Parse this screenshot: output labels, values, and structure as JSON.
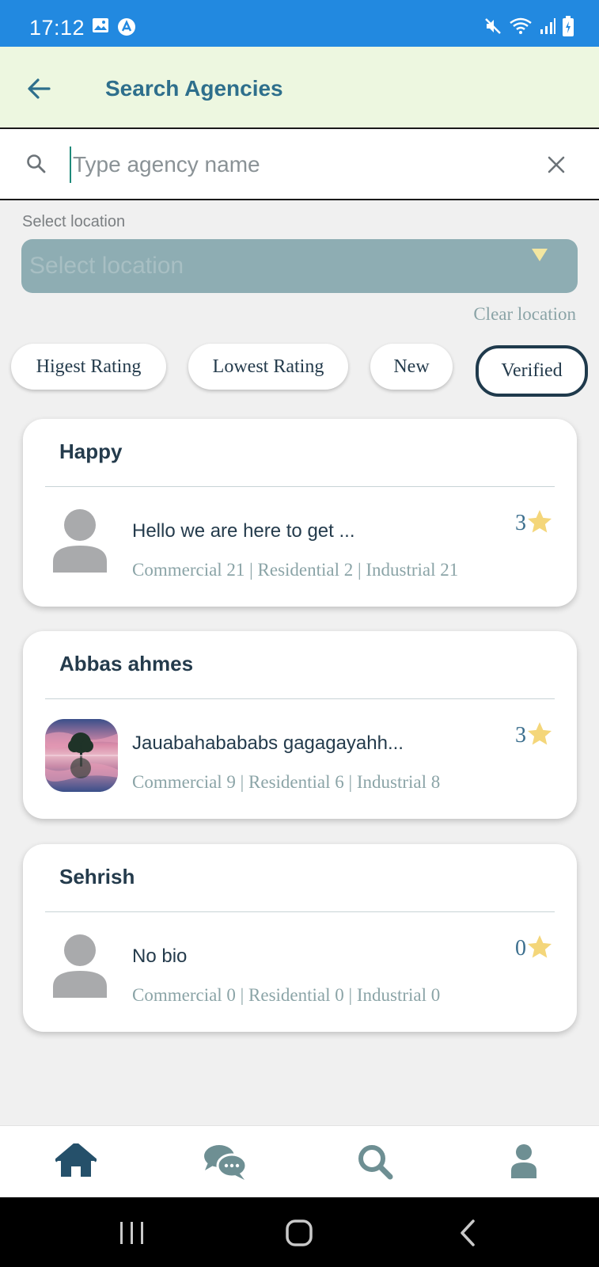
{
  "status_bar": {
    "time": "17:12",
    "left_icons": [
      "image-icon",
      "app-logo-icon"
    ],
    "right_icons": [
      "mute-icon",
      "wifi-icon",
      "signal-icon",
      "battery-icon"
    ],
    "background": "#2289e0"
  },
  "app_bar": {
    "title": "Search Agencies",
    "back_icon": "arrow-left-icon",
    "background": "#edf7e0"
  },
  "search": {
    "value": "",
    "placeholder": "Type agency name"
  },
  "location": {
    "label": "Select location",
    "select_placeholder": "Select location",
    "clear_label": "Clear location"
  },
  "filters": [
    {
      "label": "Higest Rating",
      "active": false
    },
    {
      "label": "Lowest Rating",
      "active": false
    },
    {
      "label": "New",
      "active": false
    },
    {
      "label": "Verified",
      "active": true
    }
  ],
  "agencies": [
    {
      "name": "Happy",
      "bio": "Hello we are here to get ...",
      "counts": "Commercial 21 | Residential 2 | Industrial 21",
      "rating": "3",
      "avatar": "default-person-icon"
    },
    {
      "name": "Abbas ahmes",
      "bio": "Jauabahababab​s gagagayahh...",
      "counts": "Commercial 9 | Residential 6 | Industrial 8",
      "rating": "3",
      "avatar": "tree-photo"
    },
    {
      "name": "Sehrish",
      "bio": "No bio",
      "counts": "Commercial 0 | Residential 0 | Industrial 0",
      "rating": "0",
      "avatar": "default-person-icon"
    }
  ],
  "bottom_nav": [
    "home-icon",
    "chat-icon",
    "search-icon",
    "profile-icon"
  ],
  "colors": {
    "accent": "#2e6f8c",
    "dark": "#243b4c",
    "muted": "#8ba4a7",
    "star": "#f4d67a"
  }
}
